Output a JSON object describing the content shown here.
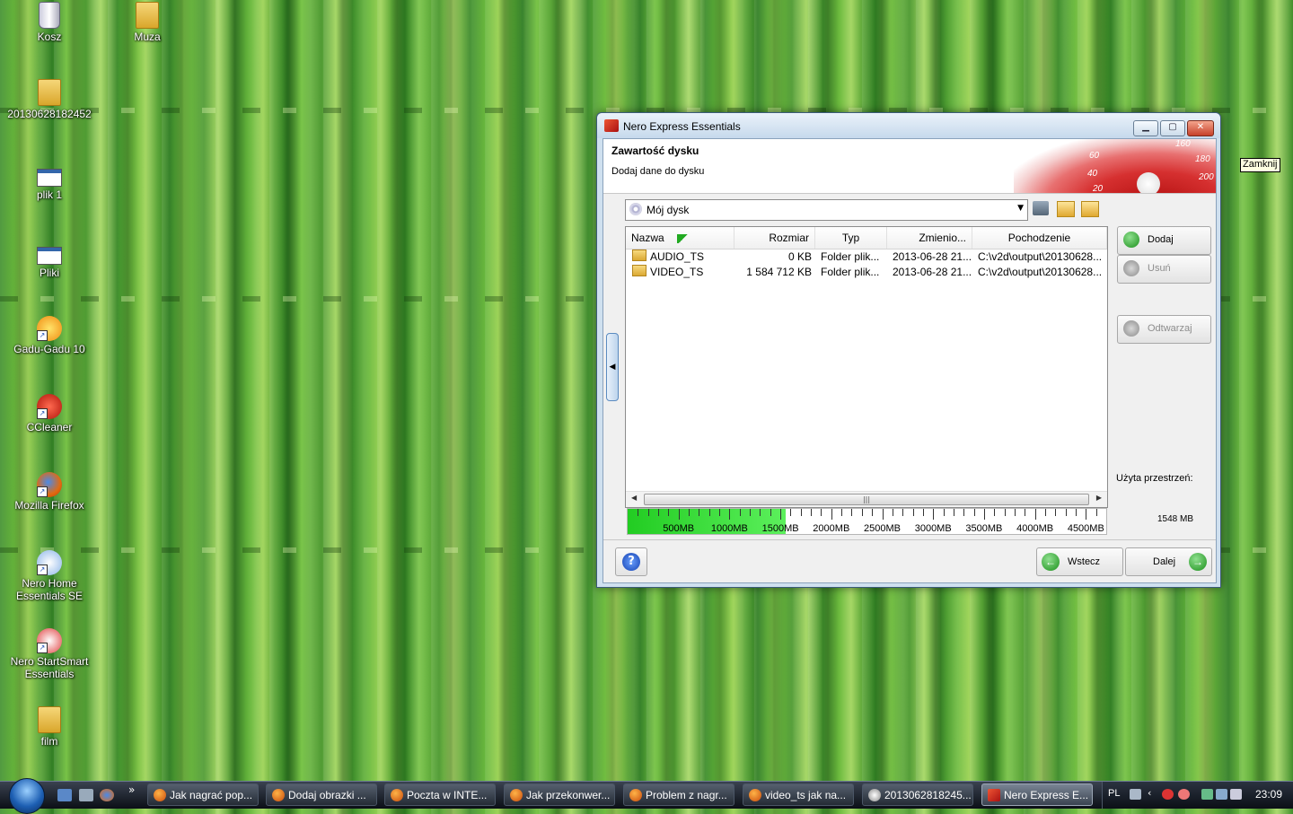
{
  "desktop": {
    "icons": [
      {
        "label": "Kosz",
        "icon": "recycle-bin-icon"
      },
      {
        "label": "Muza",
        "icon": "folder-icon"
      },
      {
        "label": "20130628182452",
        "icon": "folder-icon"
      },
      {
        "label": "plik 1",
        "icon": "program-icon"
      },
      {
        "label": "Pliki",
        "icon": "program-icon"
      },
      {
        "label": "Gadu-Gadu 10",
        "icon": "gadu-gadu-icon"
      },
      {
        "label": "CCleaner",
        "icon": "ccleaner-icon"
      },
      {
        "label": "Mozilla Firefox",
        "icon": "firefox-icon"
      },
      {
        "label": "Nero Home Essentials SE",
        "icon": "nero-home-icon"
      },
      {
        "label": "Nero StartSmart Essentials",
        "icon": "nero-startsmart-icon"
      },
      {
        "label": "film",
        "icon": "folder-icon"
      }
    ]
  },
  "window": {
    "title": "Nero Express Essentials",
    "header_title": "Zawartość dysku",
    "header_subtitle": "Dodaj dane do dysku",
    "gauge_numbers": [
      "160",
      "180",
      "60",
      "40",
      "20",
      "200"
    ],
    "disk_select": {
      "value": "Mój dysk"
    },
    "columns": [
      "Nazwa",
      "Rozmiar",
      "Typ",
      "Zmienio...",
      "Pochodzenie"
    ],
    "rows": [
      {
        "name": "AUDIO_TS",
        "size": "0 KB",
        "type": "Folder plik...",
        "modified": "2013-06-28 21...",
        "origin": "C:\\v2d\\output\\20130628..."
      },
      {
        "name": "VIDEO_TS",
        "size": "1 584 712 KB",
        "type": "Folder plik...",
        "modified": "2013-06-28 21...",
        "origin": "C:\\v2d\\output\\20130628..."
      }
    ],
    "capacity": {
      "used_mb": 1548,
      "max_mb": 4700,
      "labels": [
        "500MB",
        "1000MB",
        "1500MB",
        "2000MB",
        "2500MB",
        "3000MB",
        "3500MB",
        "4000MB",
        "4500MB"
      ],
      "fill_color": "#22cc22"
    },
    "buttons": {
      "add": "Dodaj",
      "remove": "Usuń",
      "play": "Odtwarzaj",
      "back": "Wstecz",
      "next": "Dalej"
    },
    "used_space_label": "Użyta przestrzeń:",
    "used_space_value": "1548 MB"
  },
  "tooltip": "Zamknij",
  "taskbar": {
    "items": [
      {
        "label": "Jak nagrać pop...",
        "active": false
      },
      {
        "label": "Dodaj obrazki ...",
        "active": false
      },
      {
        "label": "Poczta w INTE...",
        "active": false
      },
      {
        "label": "Jak przekonwer...",
        "active": false
      },
      {
        "label": "Problem z nagr...",
        "active": false
      },
      {
        "label": "video_ts jak na...",
        "active": false
      },
      {
        "label": "2013062818245...",
        "active": false
      },
      {
        "label": "Nero Express E...",
        "active": true
      }
    ],
    "language": "PL",
    "clock": "23:09",
    "chevron": "»"
  }
}
